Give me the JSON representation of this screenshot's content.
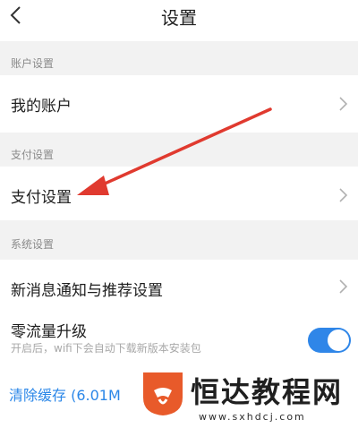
{
  "header": {
    "title": "设置"
  },
  "sections": {
    "account": {
      "label": "账户设置",
      "row_label": "我的账户"
    },
    "payment": {
      "label": "支付设置",
      "row_label": "支付设置"
    },
    "system": {
      "label": "系统设置",
      "notify_label": "新消息通知与推荐设置",
      "zero_traffic_label": "零流量升级",
      "zero_traffic_hint": "开启后，wifi下会自动下载新版本安装包",
      "zero_traffic_on": true,
      "clear_cache_label": "清除缓存 (6.01M"
    }
  },
  "watermark": {
    "title": "恒达教程网",
    "url": "www.sxhdcj.com"
  },
  "colors": {
    "accent": "#2f86e8",
    "arrow": "#e03a2f",
    "logo": "#e85a2a"
  }
}
